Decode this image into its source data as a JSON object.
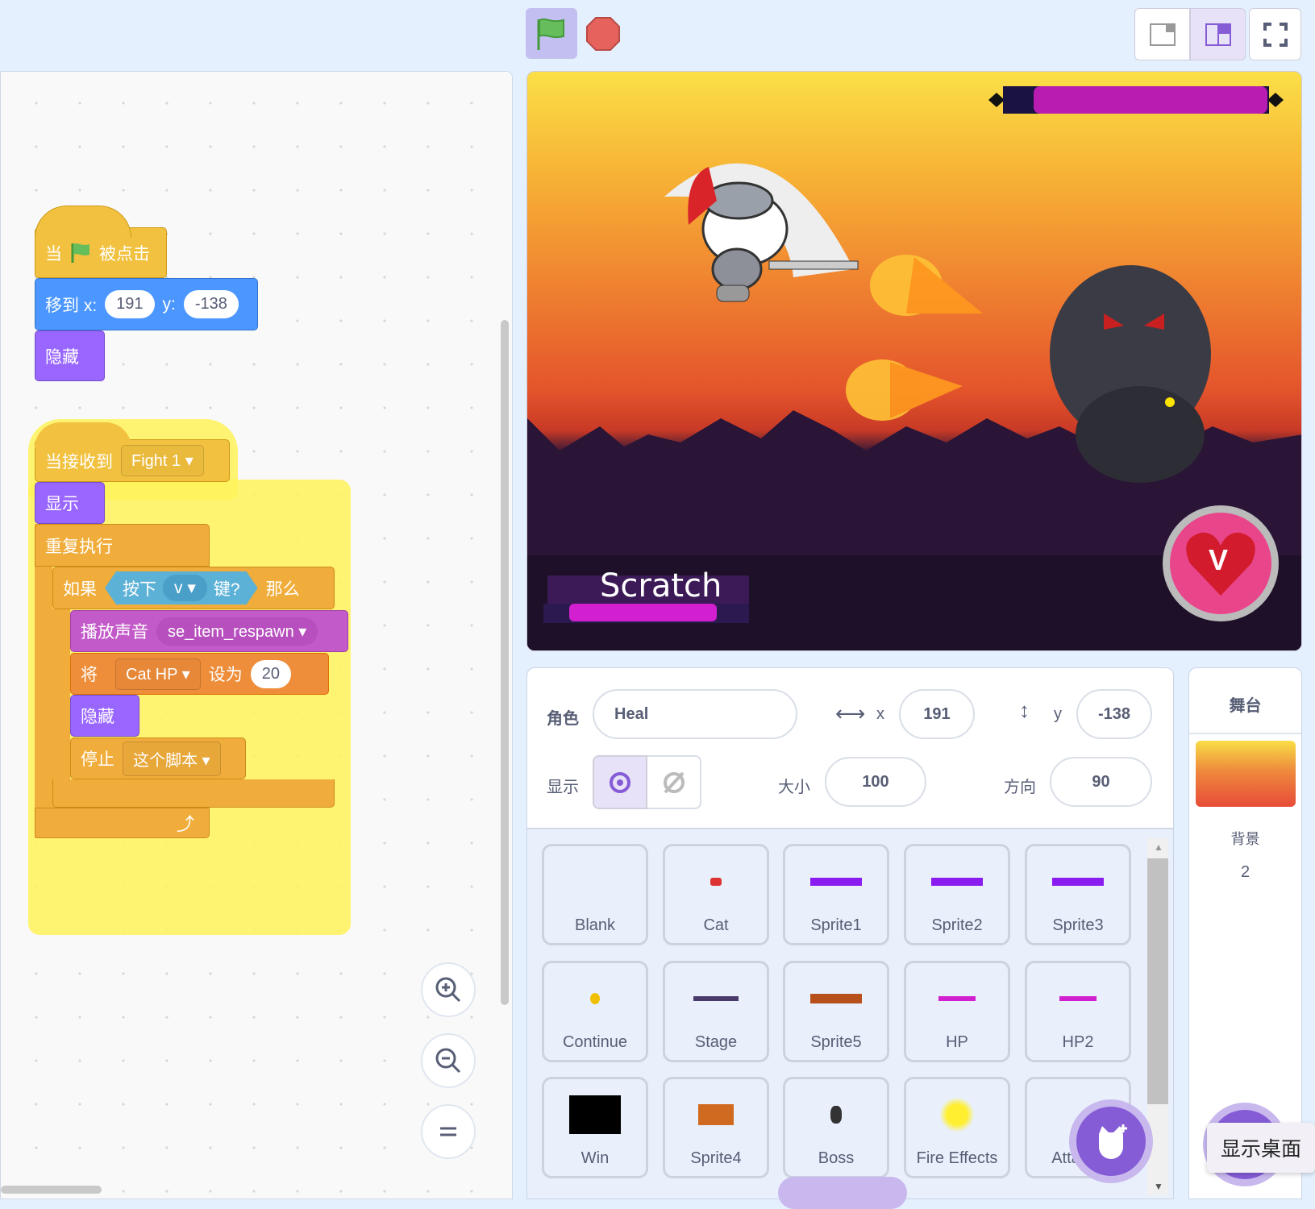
{
  "toolbar": {
    "green_flag": "green-flag-icon",
    "stop": "stop-icon"
  },
  "code": {
    "script1": {
      "hat_prefix": "当",
      "hat_suffix": "被点击",
      "move_label": "移到 x:",
      "move_x": "191",
      "move_y_label": "y:",
      "move_y": "-138",
      "hide": "隐藏"
    },
    "script2": {
      "hat_label": "当接收到",
      "message": "Fight 1",
      "show": "显示",
      "forever": "重复执行",
      "if_label": "如果",
      "key_pressed": "按下",
      "key": "v",
      "key_suffix": "键?",
      "then": "那么",
      "play_sound": "播放声音",
      "sound": "se_item_respawn",
      "set_label": "将",
      "variable": "Cat HP",
      "set_to": "设为",
      "value": "20",
      "hide": "隐藏",
      "stop_label": "停止",
      "stop_option": "这个脚本"
    }
  },
  "stage": {
    "player_name": "Scratch",
    "heart_letter": "V"
  },
  "sprite_info": {
    "sprite_label": "角色",
    "sprite_name": "Heal",
    "x_label": "x",
    "x": "191",
    "y_label": "y",
    "y": "-138",
    "show_label": "显示",
    "size_label": "大小",
    "size": "100",
    "direction_label": "方向",
    "direction": "90"
  },
  "sprites": [
    {
      "name": "Blank"
    },
    {
      "name": "Cat"
    },
    {
      "name": "Sprite1"
    },
    {
      "name": "Sprite2"
    },
    {
      "name": "Sprite3"
    },
    {
      "name": "Continue"
    },
    {
      "name": "Stage"
    },
    {
      "name": "Sprite5"
    },
    {
      "name": "HP"
    },
    {
      "name": "HP2"
    },
    {
      "name": "Win"
    },
    {
      "name": "Sprite4"
    },
    {
      "name": "Boss"
    },
    {
      "name": "Fire Effects"
    },
    {
      "name": "Attacks"
    }
  ],
  "stage_panel": {
    "title": "舞台",
    "backdrops_label": "背景",
    "backdrops_count": "2"
  },
  "tooltip": "显示桌面",
  "colors": {
    "accent": "#855cd6",
    "background": "#e5f0ff",
    "events": "#f2c13f",
    "motion": "#4c97ff",
    "looks": "#9966ff"
  }
}
